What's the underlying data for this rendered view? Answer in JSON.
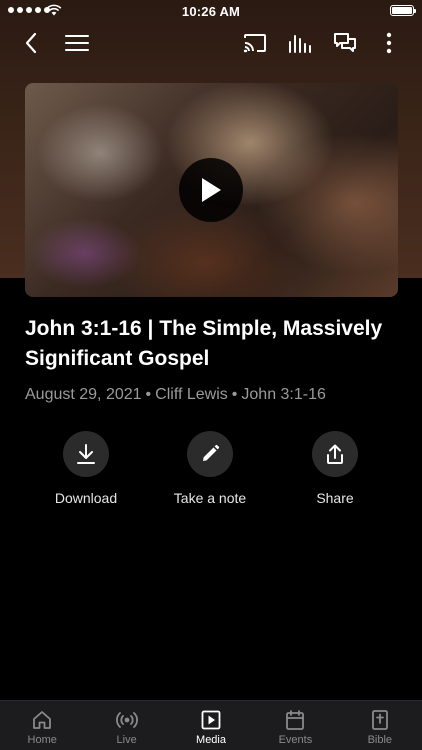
{
  "status_bar": {
    "time": "10:26 AM",
    "battery_level": 1.0
  },
  "toolbar": {
    "icons": [
      "back-chevron-icon",
      "menu-icon",
      "cast-icon",
      "audio-bars-icon",
      "chat-icon",
      "more-vertical-icon"
    ]
  },
  "video": {
    "title": "John 3:1-16 | The Simple, Massively Significant Gospel"
  },
  "meta": {
    "date": "August 29, 2021",
    "speaker": "Cliff Lewis",
    "passage": "John 3:1-16",
    "separator": "•"
  },
  "actions": [
    {
      "label": "Download",
      "icon": "download-icon"
    },
    {
      "label": "Take a note",
      "icon": "pencil-icon"
    },
    {
      "label": "Share",
      "icon": "share-icon"
    }
  ],
  "tabs": [
    {
      "label": "Home",
      "icon": "home-icon",
      "active": false
    },
    {
      "label": "Live",
      "icon": "live-broadcast-icon",
      "active": false
    },
    {
      "label": "Media",
      "icon": "media-play-icon",
      "active": true
    },
    {
      "label": "Events",
      "icon": "calendar-icon",
      "active": false
    },
    {
      "label": "Bible",
      "icon": "bible-icon",
      "active": false
    }
  ],
  "colors": {
    "background": "#000000",
    "tab_bar": "#1c1c1e",
    "meta_text": "#9a9a9a",
    "action_circle": "#2b2b2b"
  }
}
